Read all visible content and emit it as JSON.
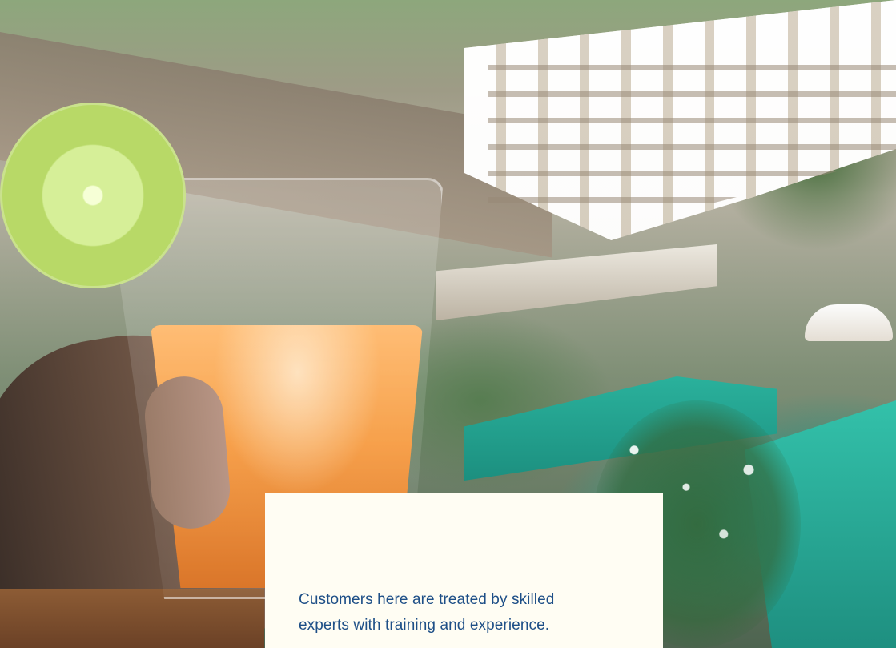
{
  "hero": {
    "alt": "Hand holding a glass of orange juice with a lime slice, overlooking a hotel pool",
    "card": {
      "line1": "Customers here are treated by skilled",
      "line2": "experts with training and experience."
    }
  },
  "colors": {
    "card_background": "#fffdf3",
    "card_text": "#1e4f87"
  }
}
